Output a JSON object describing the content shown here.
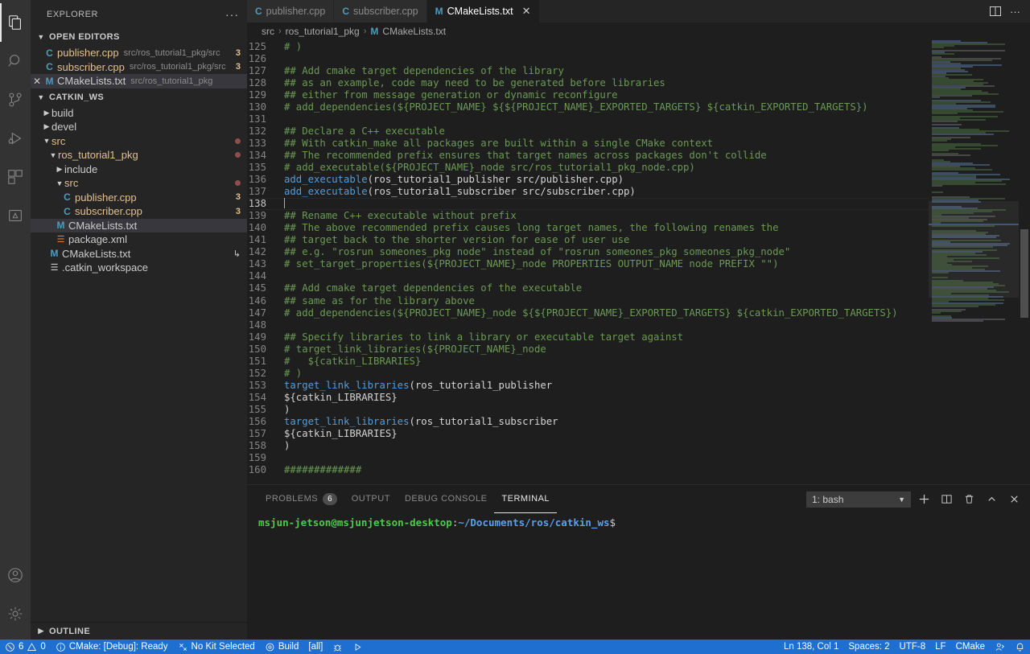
{
  "activitybar": {
    "items": [
      {
        "name": "explorer",
        "icon": "files-icon",
        "active": true
      },
      {
        "name": "search",
        "icon": "search-icon",
        "active": false
      },
      {
        "name": "source-control",
        "icon": "source-control-icon",
        "active": false
      },
      {
        "name": "run-and-debug",
        "icon": "run-debug-icon",
        "active": false
      },
      {
        "name": "extensions",
        "icon": "extensions-icon",
        "active": false
      },
      {
        "name": "cmake",
        "icon": "cmake-icon",
        "active": false
      }
    ],
    "bottom": [
      {
        "name": "accounts",
        "icon": "account-icon"
      },
      {
        "name": "manage",
        "icon": "gear-icon"
      }
    ]
  },
  "sidebar": {
    "title": "EXPLORER",
    "more_label": "···",
    "open_editors": {
      "label": "OPEN EDITORS",
      "items": [
        {
          "name": "publisher.cpp",
          "path": "src/ros_tutorial1_pkg/src",
          "icon": "cpp-icon",
          "badge": "3",
          "selected": false,
          "close": false
        },
        {
          "name": "subscriber.cpp",
          "path": "src/ros_tutorial1_pkg/src",
          "icon": "cpp-icon",
          "badge": "3",
          "selected": false,
          "close": false
        },
        {
          "name": "CMakeLists.txt",
          "path": "src/ros_tutorial1_pkg",
          "icon": "m-icon",
          "badge": "",
          "selected": true,
          "close": true
        }
      ]
    },
    "workspace": {
      "label": "CATKIN_WS",
      "items": [
        {
          "name": "build",
          "type": "folder",
          "expanded": false,
          "depth": 1,
          "badge": "",
          "modified": false
        },
        {
          "name": "devel",
          "type": "folder",
          "expanded": false,
          "depth": 1,
          "badge": "",
          "modified": false
        },
        {
          "name": "src",
          "type": "folder",
          "expanded": true,
          "depth": 1,
          "badge": "dot",
          "modified": true
        },
        {
          "name": "ros_tutorial1_pkg",
          "type": "folder",
          "expanded": true,
          "depth": 2,
          "badge": "dot",
          "modified": true
        },
        {
          "name": "include",
          "type": "folder",
          "expanded": false,
          "depth": 3,
          "badge": "",
          "modified": false
        },
        {
          "name": "src",
          "type": "folder",
          "expanded": true,
          "depth": 3,
          "badge": "dot",
          "modified": true
        },
        {
          "name": "publisher.cpp",
          "type": "cpp",
          "expanded": null,
          "depth": 4,
          "badge": "3",
          "modified": true
        },
        {
          "name": "subscriber.cpp",
          "type": "cpp",
          "expanded": null,
          "depth": 4,
          "badge": "3",
          "modified": true
        },
        {
          "name": "CMakeLists.txt",
          "type": "m",
          "expanded": null,
          "depth": 3,
          "badge": "",
          "modified": false,
          "selected": true
        },
        {
          "name": "package.xml",
          "type": "xml",
          "expanded": null,
          "depth": 3,
          "badge": "",
          "modified": false
        },
        {
          "name": "CMakeLists.txt",
          "type": "m",
          "expanded": null,
          "depth": 2,
          "badge": "link",
          "modified": false
        },
        {
          "name": ".catkin_workspace",
          "type": "cfg",
          "expanded": null,
          "depth": 2,
          "badge": "",
          "modified": false
        }
      ]
    },
    "outline_label": "OUTLINE"
  },
  "tabs": [
    {
      "label": "publisher.cpp",
      "icon": "cpp-icon",
      "active": false,
      "closable": false
    },
    {
      "label": "subscriber.cpp",
      "icon": "cpp-icon",
      "active": false,
      "closable": false
    },
    {
      "label": "CMakeLists.txt",
      "icon": "m-icon",
      "active": true,
      "closable": true
    }
  ],
  "tab_actions": [
    {
      "name": "split-editor-icon"
    },
    {
      "name": "more-actions-icon",
      "label": "···"
    }
  ],
  "breadcrumb": {
    "parts": [
      "src",
      "ros_tutorial1_pkg",
      "CMakeLists.txt"
    ],
    "separator": "›",
    "file_icon": "m-icon"
  },
  "editor": {
    "first_line": 125,
    "lines": [
      {
        "n": 125,
        "segments": [
          {
            "t": "# )",
            "c": "cm"
          }
        ]
      },
      {
        "n": 126,
        "segments": []
      },
      {
        "n": 127,
        "segments": [
          {
            "t": "## Add cmake target dependencies of the library",
            "c": "cm"
          }
        ]
      },
      {
        "n": 128,
        "segments": [
          {
            "t": "## as an example, code may need to be generated before libraries",
            "c": "cm"
          }
        ]
      },
      {
        "n": 129,
        "segments": [
          {
            "t": "## either from message generation or dynamic reconfigure",
            "c": "cm"
          }
        ]
      },
      {
        "n": 130,
        "segments": [
          {
            "t": "# add_dependencies(${PROJECT_NAME} ${${PROJECT_NAME}_EXPORTED_TARGETS} ${catkin_EXPORTED_TARGETS})",
            "c": "cm"
          }
        ]
      },
      {
        "n": 131,
        "segments": []
      },
      {
        "n": 132,
        "segments": [
          {
            "t": "## Declare a C++ executable",
            "c": "cm"
          }
        ]
      },
      {
        "n": 133,
        "segments": [
          {
            "t": "## With catkin_make all packages are built within a single CMake context",
            "c": "cm"
          }
        ]
      },
      {
        "n": 134,
        "segments": [
          {
            "t": "## The recommended prefix ensures that target names across packages don't collide",
            "c": "cm"
          }
        ]
      },
      {
        "n": 135,
        "segments": [
          {
            "t": "# add_executable(${PROJECT_NAME}_node src/ros_tutorial1_pkg_node.cpp)",
            "c": "cm"
          }
        ]
      },
      {
        "n": 136,
        "segments": [
          {
            "t": "add_executable",
            "c": "fn"
          },
          {
            "t": "(ros_tutorial1_publisher src/publisher.cpp)",
            "c": "pn"
          }
        ]
      },
      {
        "n": 137,
        "segments": [
          {
            "t": "add_executable",
            "c": "fn"
          },
          {
            "t": "(ros_tutorial1_subscriber src/subscriber.cpp)",
            "c": "pn"
          }
        ]
      },
      {
        "n": 138,
        "segments": [],
        "current": true,
        "caret": true
      },
      {
        "n": 139,
        "segments": [
          {
            "t": "## Rename C++ executable without prefix",
            "c": "cm"
          }
        ]
      },
      {
        "n": 140,
        "segments": [
          {
            "t": "## The above recommended prefix causes long target names, the following renames the",
            "c": "cm"
          }
        ]
      },
      {
        "n": 141,
        "segments": [
          {
            "t": "## target back to the shorter version for ease of user use",
            "c": "cm"
          }
        ]
      },
      {
        "n": 142,
        "segments": [
          {
            "t": "## e.g. \"rosrun someones_pkg node\" instead of \"rosrun someones_pkg someones_pkg_node\"",
            "c": "cm"
          }
        ]
      },
      {
        "n": 143,
        "segments": [
          {
            "t": "# set_target_properties(${PROJECT_NAME}_node PROPERTIES OUTPUT_NAME node PREFIX \"\")",
            "c": "cm"
          }
        ]
      },
      {
        "n": 144,
        "segments": []
      },
      {
        "n": 145,
        "segments": [
          {
            "t": "## Add cmake target dependencies of the executable",
            "c": "cm"
          }
        ]
      },
      {
        "n": 146,
        "segments": [
          {
            "t": "## same as for the library above",
            "c": "cm"
          }
        ]
      },
      {
        "n": 147,
        "segments": [
          {
            "t": "# add_dependencies(${PROJECT_NAME}_node ${${PROJECT_NAME}_EXPORTED_TARGETS} ${catkin_EXPORTED_TARGETS})",
            "c": "cm"
          }
        ]
      },
      {
        "n": 148,
        "segments": []
      },
      {
        "n": 149,
        "segments": [
          {
            "t": "## Specify libraries to link a library or executable target against",
            "c": "cm"
          }
        ]
      },
      {
        "n": 150,
        "segments": [
          {
            "t": "# target_link_libraries(${PROJECT_NAME}_node",
            "c": "cm"
          }
        ]
      },
      {
        "n": 151,
        "segments": [
          {
            "t": "#   ${catkin_LIBRARIES}",
            "c": "cm"
          }
        ]
      },
      {
        "n": 152,
        "segments": [
          {
            "t": "# )",
            "c": "cm"
          }
        ]
      },
      {
        "n": 153,
        "segments": [
          {
            "t": "target_link_libraries",
            "c": "fn"
          },
          {
            "t": "(ros_tutorial1_publisher",
            "c": "pn"
          }
        ]
      },
      {
        "n": 154,
        "segments": [
          {
            "t": "${catkin_LIBRARIES}",
            "c": "pn"
          }
        ]
      },
      {
        "n": 155,
        "segments": [
          {
            "t": ")",
            "c": "pn"
          }
        ]
      },
      {
        "n": 156,
        "segments": [
          {
            "t": "target_link_libraries",
            "c": "fn"
          },
          {
            "t": "(ros_tutorial1_subscriber",
            "c": "pn"
          }
        ]
      },
      {
        "n": 157,
        "segments": [
          {
            "t": "${catkin_LIBRARIES}",
            "c": "pn"
          }
        ]
      },
      {
        "n": 158,
        "segments": [
          {
            "t": ")",
            "c": "pn"
          }
        ]
      },
      {
        "n": 159,
        "segments": []
      },
      {
        "n": 160,
        "segments": [
          {
            "t": "#############",
            "c": "cm"
          }
        ]
      }
    ]
  },
  "panel": {
    "tabs": [
      {
        "label": "PROBLEMS",
        "count": "6",
        "active": false
      },
      {
        "label": "OUTPUT",
        "count": "",
        "active": false
      },
      {
        "label": "DEBUG CONSOLE",
        "count": "",
        "active": false
      },
      {
        "label": "TERMINAL",
        "count": "",
        "active": true
      }
    ],
    "terminal_select": "1: bash",
    "actions": [
      {
        "name": "new-terminal-icon"
      },
      {
        "name": "split-terminal-icon"
      },
      {
        "name": "kill-terminal-icon"
      },
      {
        "name": "maximize-panel-icon"
      },
      {
        "name": "close-panel-icon"
      }
    ],
    "terminal": {
      "user": "msjun-jetson@msjunjetson-desktop",
      "colon": ":",
      "path": "~/Documents/ros/catkin_ws",
      "prompt": "$"
    }
  },
  "statusbar": {
    "left": [
      {
        "name": "problems-status",
        "icon": "error-icon",
        "label": "6",
        "icon2": "warning-icon",
        "label2": "0"
      },
      {
        "name": "cmake-status",
        "icon": "info-icon",
        "label": "CMake: [Debug]: Ready"
      },
      {
        "name": "kit-status",
        "icon": "tools-icon",
        "label": "No Kit Selected"
      },
      {
        "name": "build-status",
        "icon": "gear-icon",
        "label": "Build"
      },
      {
        "name": "target-status",
        "icon": "",
        "label": "[all]"
      },
      {
        "name": "debug-status",
        "icon": "bug-icon",
        "label": ""
      },
      {
        "name": "launch-status",
        "icon": "play-icon",
        "label": ""
      }
    ],
    "right": [
      {
        "name": "cursor-position",
        "label": "Ln 138, Col 1"
      },
      {
        "name": "indentation",
        "label": "Spaces: 2"
      },
      {
        "name": "encoding",
        "label": "UTF-8"
      },
      {
        "name": "eol",
        "label": "LF"
      },
      {
        "name": "language-mode",
        "label": "CMake"
      },
      {
        "name": "live-share",
        "label": "",
        "icon": "live-share-icon"
      },
      {
        "name": "notifications",
        "label": "",
        "icon": "bell-icon"
      }
    ]
  },
  "colors": {
    "accent": "#1f6fd0",
    "comment": "#6a9955",
    "function": "#569cd6",
    "modified": "#e2c08d",
    "editor_bg": "#1e1e1e",
    "sidebar_bg": "#252526"
  }
}
